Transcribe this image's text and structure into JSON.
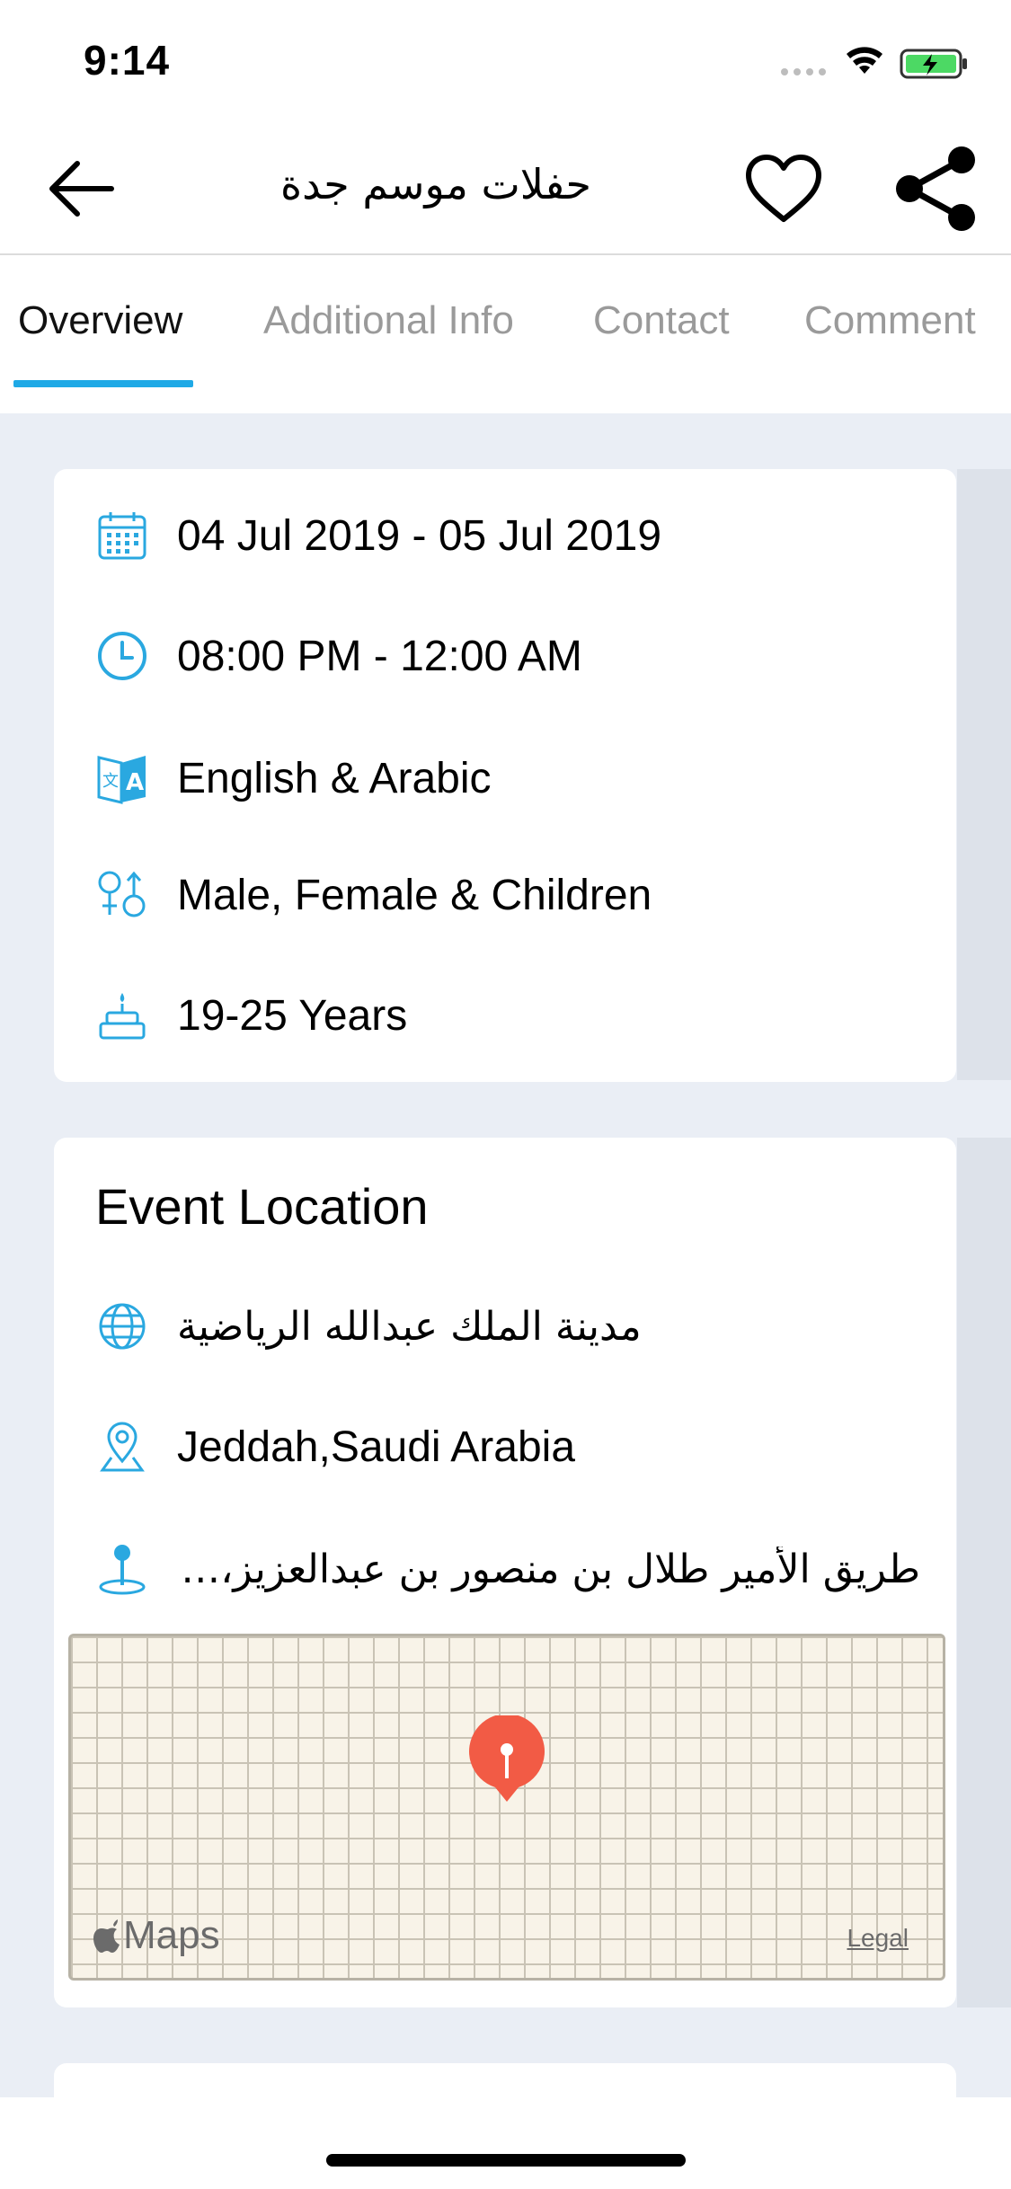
{
  "status_bar": {
    "time": "9:14"
  },
  "header": {
    "title": "حفلات موسم جدة"
  },
  "tabs": [
    {
      "label": "Overview",
      "active": true
    },
    {
      "label": "Additional Info",
      "active": false
    },
    {
      "label": "Contact",
      "active": false
    },
    {
      "label": "Comment",
      "active": false
    }
  ],
  "overview": {
    "date_range": "04 Jul 2019 - 05 Jul 2019",
    "time_range": "08:00 PM - 12:00 AM",
    "languages": "English & Arabic",
    "audience": "Male, Female & Children",
    "age_range": "19-25 Years"
  },
  "location": {
    "title": "Event Location",
    "venue": "مدينة الملك عبدالله الرياضية",
    "city": "Jeddah,Saudi Arabia",
    "address": "طريق الأمير طلال بن منصور بن عبدالعزيز، ا..."
  },
  "map": {
    "brand": "Maps",
    "legal": "Legal"
  },
  "colors": {
    "accent": "#1fa9e6",
    "icon": "#2aa8e0",
    "pin": "#f25b45"
  }
}
